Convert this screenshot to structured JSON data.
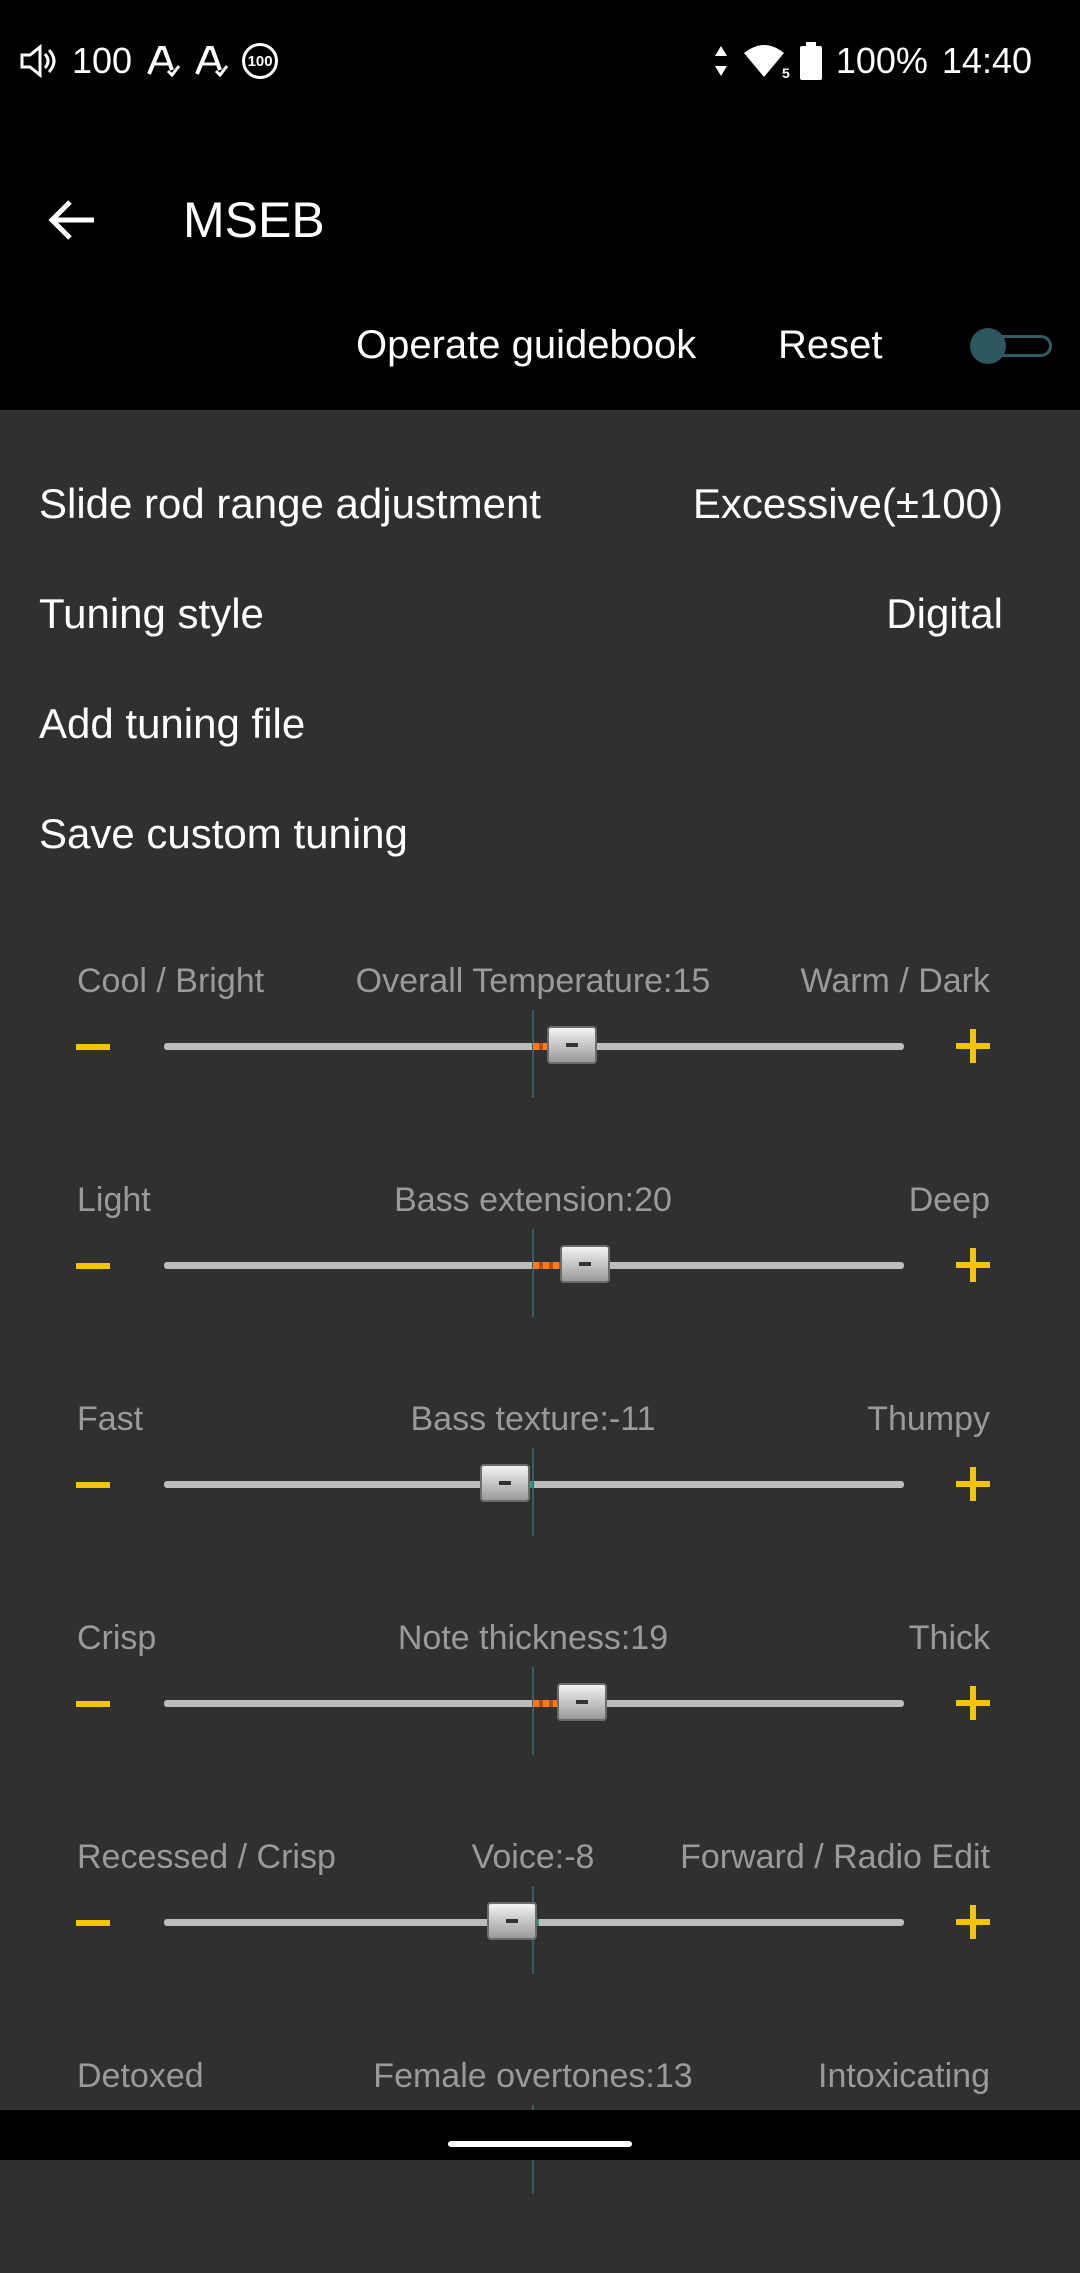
{
  "status": {
    "volume": "100",
    "battery": "100%",
    "time": "14:40",
    "signal_sub": "5",
    "badge": "100"
  },
  "header": {
    "title": "MSEB",
    "guide_label": "Operate guidebook",
    "reset_label": "Reset",
    "toggle_on": false
  },
  "settings": [
    {
      "label": "Slide rod range adjustment",
      "value": "Excessive(±100)"
    },
    {
      "label": "Tuning style",
      "value": "Digital"
    },
    {
      "label": "Add tuning file",
      "value": ""
    },
    {
      "label": "Save custom tuning",
      "value": ""
    }
  ],
  "sliders": [
    {
      "left": "Cool / Bright",
      "center": "Overall Temperature:15",
      "right": "Warm / Dark",
      "value": 15
    },
    {
      "left": "Light",
      "center": "Bass extension:20",
      "right": "Deep",
      "value": 20
    },
    {
      "left": "Fast",
      "center": "Bass texture:-11",
      "right": "Thumpy",
      "value": -11
    },
    {
      "left": "Crisp",
      "center": "Note thickness:19",
      "right": "Thick",
      "value": 19
    },
    {
      "left": "Recessed / Crisp",
      "center": "Voice:-8",
      "right": "Forward / Radio Edit",
      "value": -8
    },
    {
      "left": "Detoxed",
      "center": "Female overtones:13",
      "right": "Intoxicating",
      "value": 13
    }
  ],
  "colors": {
    "accent": "#f5c400",
    "positive_fill": "#ff7a1a",
    "negative_fill": "#1fa07a"
  }
}
